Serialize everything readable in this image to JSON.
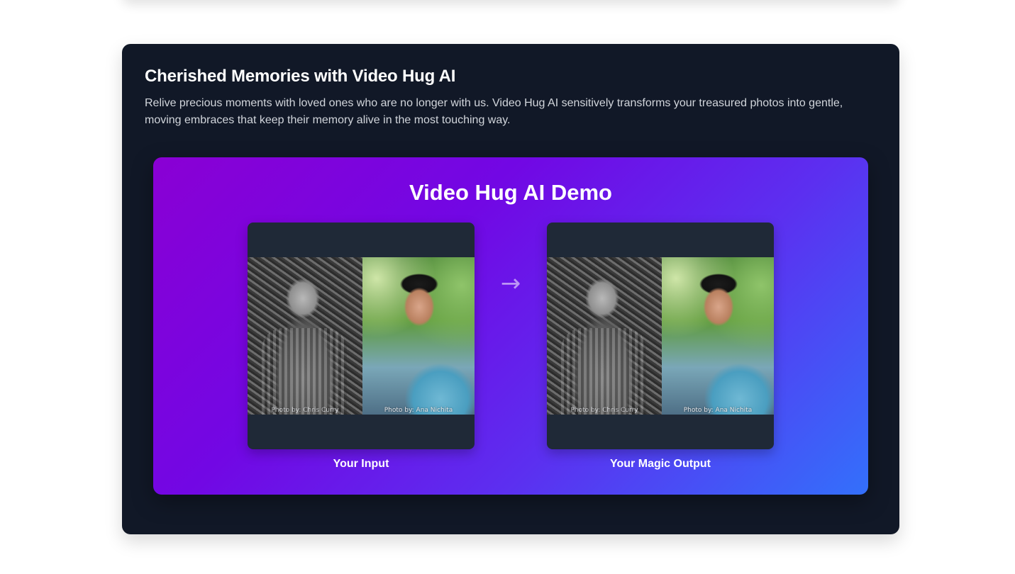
{
  "section": {
    "title": "Cherished Memories with Video Hug AI",
    "description": "Relive precious moments with loved ones who are no longer with us. Video Hug AI sensitively transforms your treasured photos into gentle, moving embraces that keep their memory alive in the most touching way."
  },
  "demo": {
    "title": "Video Hug AI Demo",
    "arrow": "→",
    "input": {
      "caption": "Your Input",
      "credit_left": "Photo by: Chris Curry",
      "credit_right": "Photo by: Ana Nichita"
    },
    "output": {
      "caption": "Your Magic Output",
      "credit_left": "Photo by: Chris Curry",
      "credit_right": "Photo by: Ana Nichita"
    }
  },
  "colors": {
    "section_bg": "#111827",
    "panel_bg": "#1f2937",
    "gradient_start": "#8a00d4",
    "gradient_end": "#3370fb"
  }
}
